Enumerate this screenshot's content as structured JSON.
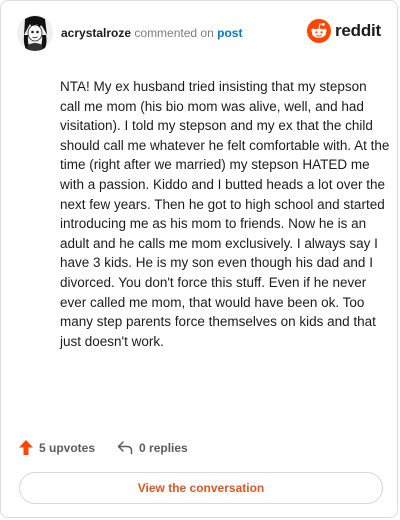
{
  "header": {
    "username": "acrystalroze",
    "action_text": "commented on",
    "post_link": "post",
    "brand_name": "reddit"
  },
  "comment": {
    "text": "NTA! My ex husband tried insisting that my stepson call me mom (his bio mom was alive, well, and had visitation). I told my stepson and my ex that the child should call me whatever he felt comfortable with. At the time (right after we married) my stepson HATED me with a passion. Kiddo and I butted heads a lot over the next few years. Then he got to high school and started introducing me as his mom to friends. Now he is an adult and he calls me mom exclusively. I always say I have 3 kids. He is my son even though his dad and I divorced. You don't force this stuff. Even if he never ever called me mom, that would have been ok. Too many step parents force themselves on kids and that just doesn't work."
  },
  "footer": {
    "upvotes_label": "5 upvotes",
    "replies_label": "0 replies",
    "view_button_label": "View the conversation"
  },
  "colors": {
    "brand": "#ff4500",
    "link": "#0079d3",
    "button_text": "#e0561c"
  }
}
